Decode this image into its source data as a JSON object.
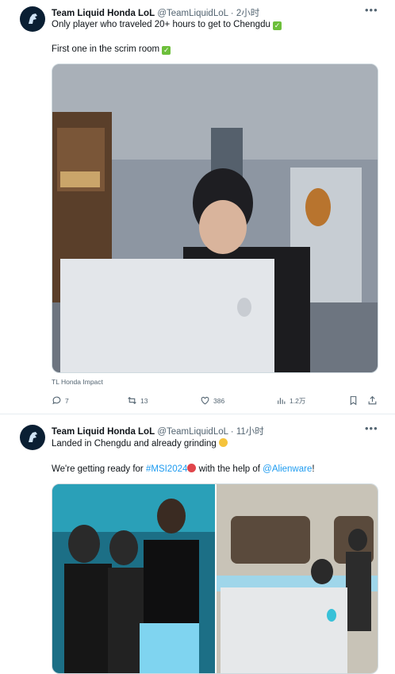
{
  "tweets": [
    {
      "author_name": "Team Liquid Honda LoL",
      "handle": "@TeamLiquidLoL",
      "separator": "·",
      "time": "2小时",
      "line1": "Only player who traveled 20+ hours to get to Chengdu",
      "line2": "First one in the scrim room",
      "media_caption": "TL Honda Impact",
      "stats": {
        "replies": "7",
        "retweets": "13",
        "likes": "386",
        "views": "1.2万"
      }
    },
    {
      "author_name": "Team Liquid Honda LoL",
      "handle": "@TeamLiquidLoL",
      "separator": "·",
      "time": "11小时",
      "line1": "Landed in Chengdu and already grinding",
      "line2_prefix": "We're getting ready for",
      "hashtag": "#MSI2024",
      "line2_mid": "with the help of",
      "mention": "@Alienware",
      "line2_suffix": "!"
    }
  ],
  "icons": {
    "verified": "check-mark-emoji",
    "grinding": "grimace-emoji",
    "hashtag_emoji": "msi-emblem"
  },
  "colors": {
    "link": "#1d9bf0",
    "muted": "#536471",
    "avatar_bg": "#0a1f33"
  }
}
